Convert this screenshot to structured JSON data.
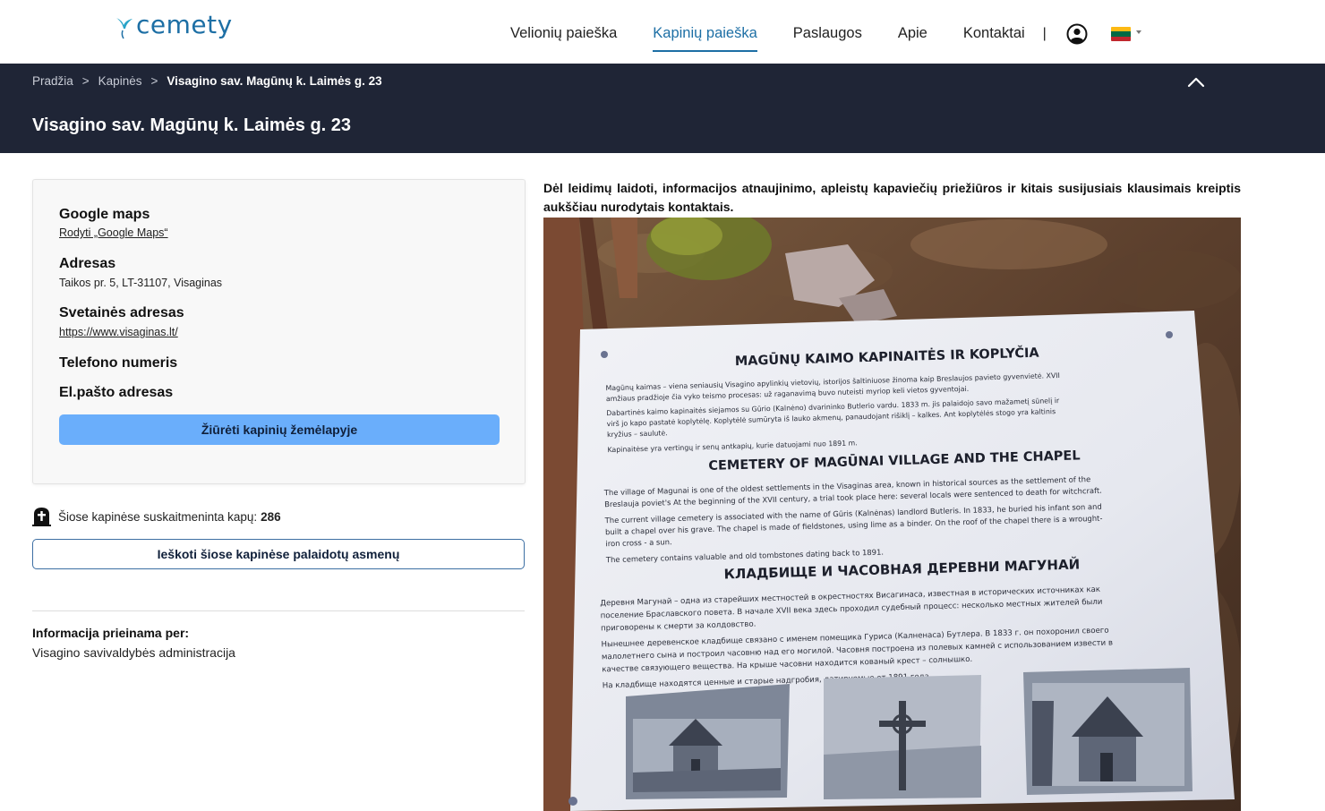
{
  "brand": {
    "logo_text": "cemety"
  },
  "nav": {
    "items": [
      {
        "label": "Velionių paieška",
        "active": false
      },
      {
        "label": "Kapinių paieška",
        "active": true
      },
      {
        "label": "Paslaugos",
        "active": false
      },
      {
        "label": "Apie",
        "active": false
      },
      {
        "label": "Kontaktai",
        "active": false
      }
    ],
    "separator": "|",
    "user_icon": "user-circle-icon",
    "language_icon": "flag-lt-icon",
    "flag_colors": [
      "#fdb913",
      "#006a44",
      "#c1272d"
    ]
  },
  "breadcrumb": {
    "items": [
      "Pradžia",
      "Kapinės"
    ],
    "current": "Visagino sav. Magūnų k. Laimės g. 23",
    "separator": ">"
  },
  "page": {
    "title": "Visagino sav. Magūnų k. Laimės g. 23"
  },
  "info": {
    "google_maps_label": "Google maps",
    "google_maps_link": "Rodyti „Google Maps“",
    "address_label": "Adresas",
    "address_value": "Taikos pr. 5, LT-31107, Visaginas",
    "website_label": "Svetainės adresas",
    "website_value": "https://www.visaginas.lt/",
    "phone_label": "Telefono numeris",
    "email_label": "El.pašto adresas",
    "map_button": "Žiūrėti kapinių žemėlapyje"
  },
  "stats": {
    "count_text": "Šiose kapinėse suskaitmeninta kapų:",
    "count_value": "286",
    "search_button": "Ieškoti šiose kapinėse palaidotų asmenų"
  },
  "availability": {
    "label": "Informacija prieinama per:",
    "value": "Visagino savivaldybės administracija"
  },
  "notice": "Dėl leidimų laidoti, informacijos atnaujinimo, apleistų kapaviečių priežiūros ir kitais susijusiais klausimais kreiptis aukščiau nurodytais kontaktais.",
  "photo": {
    "sign_title_lt": "MAGŪNŲ KAIMO KAPINAITĖS IR KOPLYČIA",
    "sign_lt_lines": [
      "Magūnų kaimas – viena seniausių Visagino apylinkių vietovių, istorijos šaltiniuose žinoma kaip Breslaujos pavieto gyvenvietė. XVII",
      "amžiaus pradžioje čia vyko teismo procesas: už raganavimą buvo nuteisti myriop keli vietos gyventojai.",
      "Dabartinės kaimo kapinaitės siejamos su Gūrio (Kalnėno) dvarininko Butlerio vardu. 1833 m. jis palaidojo savo mažametį sūnelį ir",
      "virš jo kapo pastatė koplytėlę. Koplytėlė sumūryta iš lauko akmenų, panaudojant rišiklį – kalkes. Ant koplytėlės stogo yra kaltinis",
      "kryžius – saulutė.",
      "Kapinaitėse yra vertingų ir senų antkapių, kurie datuojami nuo 1891 m."
    ],
    "sign_title_en": "CEMETERY OF MAGŪNAI VILLAGE AND THE CHAPEL",
    "sign_en_lines": [
      "The village of Magunai is one of the oldest settlements in the Visaginas area, known in historical sources as the settlement of the",
      "Breslauja poviet's At the beginning of the XVII century, a trial took place here: several locals were sentenced to death for witchcraft.",
      "The current village cemetery is associated with the name of Gūris (Kalnėnas) landlord Butleris. In 1833, he buried his infant son and",
      "built a chapel over his grave. The chapel is made of fieldstones, using lime as a binder. On the roof of the chapel there is a wrought-",
      "iron cross - a sun.",
      "The cemetery contains valuable and old tombstones dating back to 1891."
    ],
    "sign_title_ru": "КЛАДБИЩЕ И ЧАСОВНАЯ ДЕРЕВНИ МАГУНАЙ",
    "sign_ru_lines": [
      "Деревня Магунай – одна из старейших местностей в окрестностях Висагинаса, известная в исторических источниках как",
      "поселение Браславского повета. В начале XVII века здесь проходил судебный процесс: несколько местных жителей были",
      "приговорены к смерти за колдовство.",
      "Нынешнее деревенское кладбище связано с именем помещика Гуриса (Калненаса) Бутлера. В 1833 г. он похоронил своего",
      "малолетнего сына и построил часовню над его могилой. Часовня построена из полевых камней с использованием извести в",
      "качестве связующего вещества. На крыше часовни находится кованый крест – солнышко.",
      "На кладбище находятся ценные и старые надгробия, датируемые от 1891 года."
    ]
  }
}
